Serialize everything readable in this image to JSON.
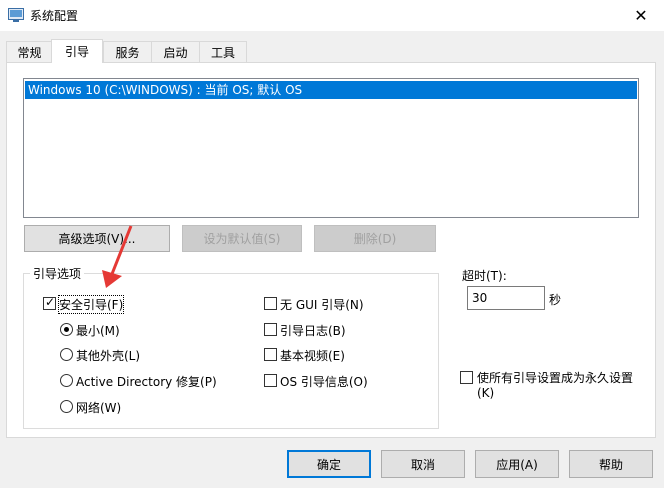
{
  "window": {
    "title": "系统配置",
    "close_glyph": "✕"
  },
  "tabs": [
    {
      "label": "常规"
    },
    {
      "label": "引导"
    },
    {
      "label": "服务"
    },
    {
      "label": "启动"
    },
    {
      "label": "工具"
    }
  ],
  "os_list": {
    "items": [
      {
        "label": "Windows 10 (C:\\WINDOWS) : 当前 OS; 默认 OS",
        "selected": true
      }
    ]
  },
  "buttons": {
    "advanced": "高级选项(V)...",
    "set_default": "设为默认值(S)",
    "delete": "删除(D)"
  },
  "boot_options": {
    "legend": "引导选项",
    "safe_boot": {
      "label": "安全引导(F)",
      "checked": true
    },
    "minimal": {
      "label": "最小(M)",
      "selected": true
    },
    "alternate_shell": {
      "label": "其他外壳(L)",
      "selected": false
    },
    "ad_repair": {
      "label": "Active Directory 修复(P)",
      "selected": false
    },
    "network": {
      "label": "网络(W)",
      "selected": false
    },
    "no_gui_boot": {
      "label": "无 GUI 引导(N)",
      "checked": false
    },
    "boot_log": {
      "label": "引导日志(B)",
      "checked": false
    },
    "base_video": {
      "label": "基本视频(E)",
      "checked": false
    },
    "os_boot_info": {
      "label": "OS 引导信息(O)",
      "checked": false
    }
  },
  "timeout": {
    "label": "超时(T):",
    "value": "30",
    "unit": "秒"
  },
  "permanent": {
    "label_line1": "使所有引导设置成为永久设置",
    "label_line2": "(K)",
    "checked": false
  },
  "footer": {
    "ok": "确定",
    "cancel": "取消",
    "apply": "应用(A)",
    "help": "帮助"
  },
  "colors": {
    "accent": "#0078d7",
    "annotation_arrow": "#e53935"
  }
}
